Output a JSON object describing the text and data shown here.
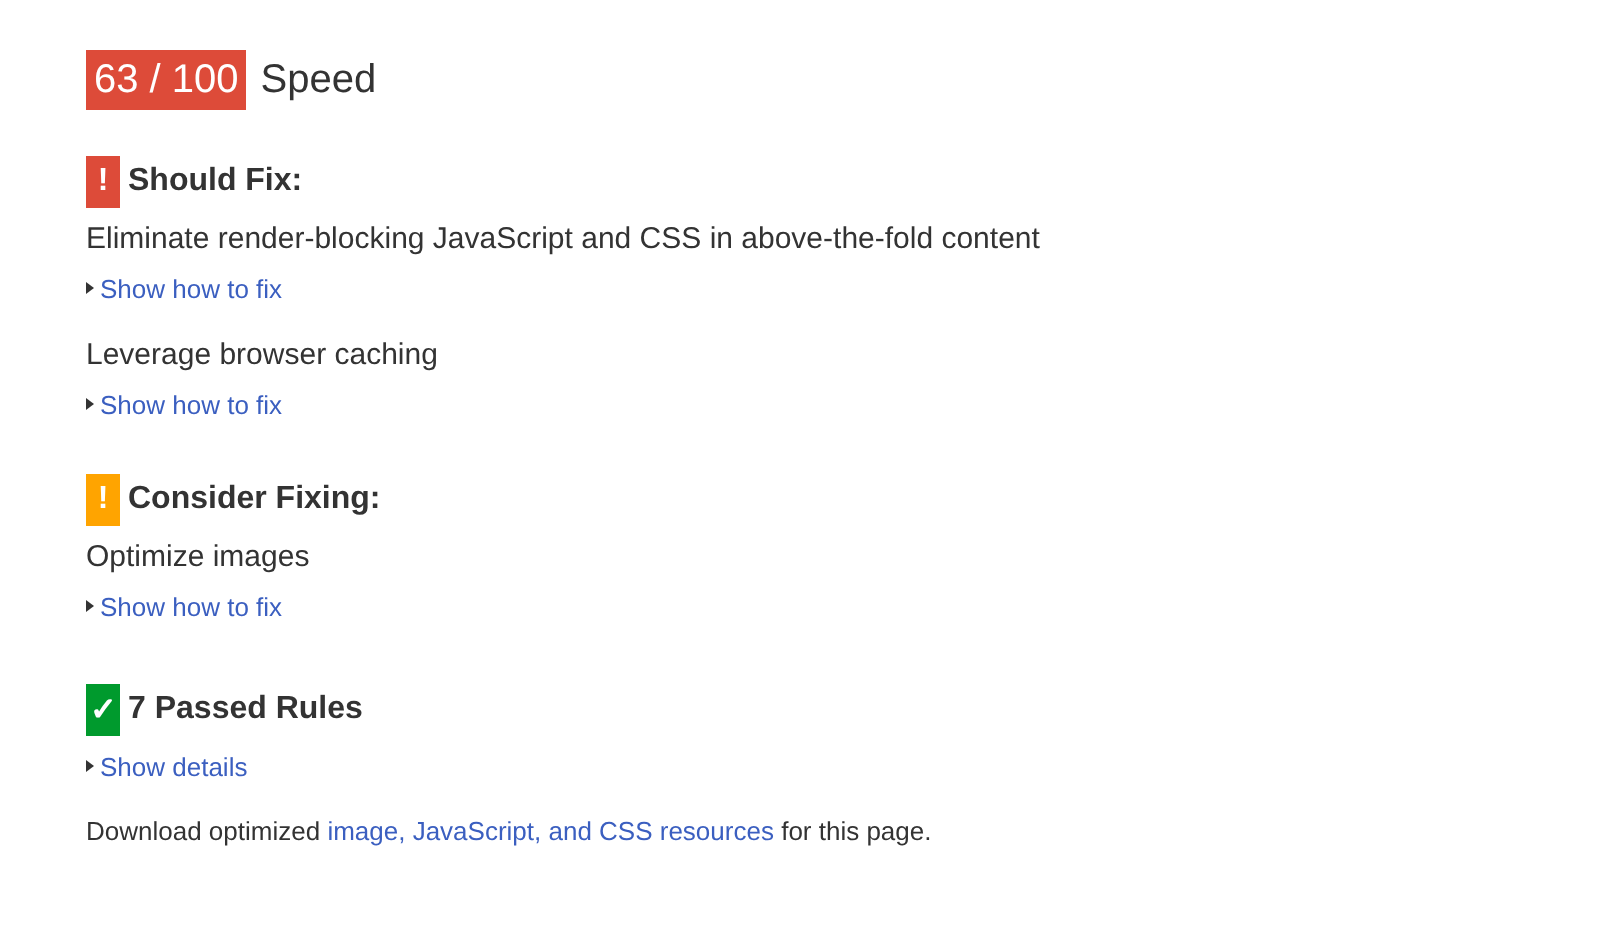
{
  "score": {
    "value": "63 / 100",
    "label": "Speed"
  },
  "sections": [
    {
      "kind": "should_fix",
      "icon": "!",
      "title": "Should Fix:",
      "rules": [
        {
          "title": "Eliminate render-blocking JavaScript and CSS in above-the-fold content",
          "link": "Show how to fix"
        },
        {
          "title": "Leverage browser caching",
          "link": "Show how to fix"
        }
      ]
    },
    {
      "kind": "consider",
      "icon": "!",
      "title": "Consider Fixing:",
      "rules": [
        {
          "title": "Optimize images",
          "link": "Show how to fix"
        }
      ]
    },
    {
      "kind": "passed",
      "icon": "✓",
      "title": "7 Passed Rules",
      "link": "Show details"
    }
  ],
  "footer": {
    "before": "Download optimized",
    "link": "image, JavaScript, and CSS resources",
    "after": "for this page."
  }
}
